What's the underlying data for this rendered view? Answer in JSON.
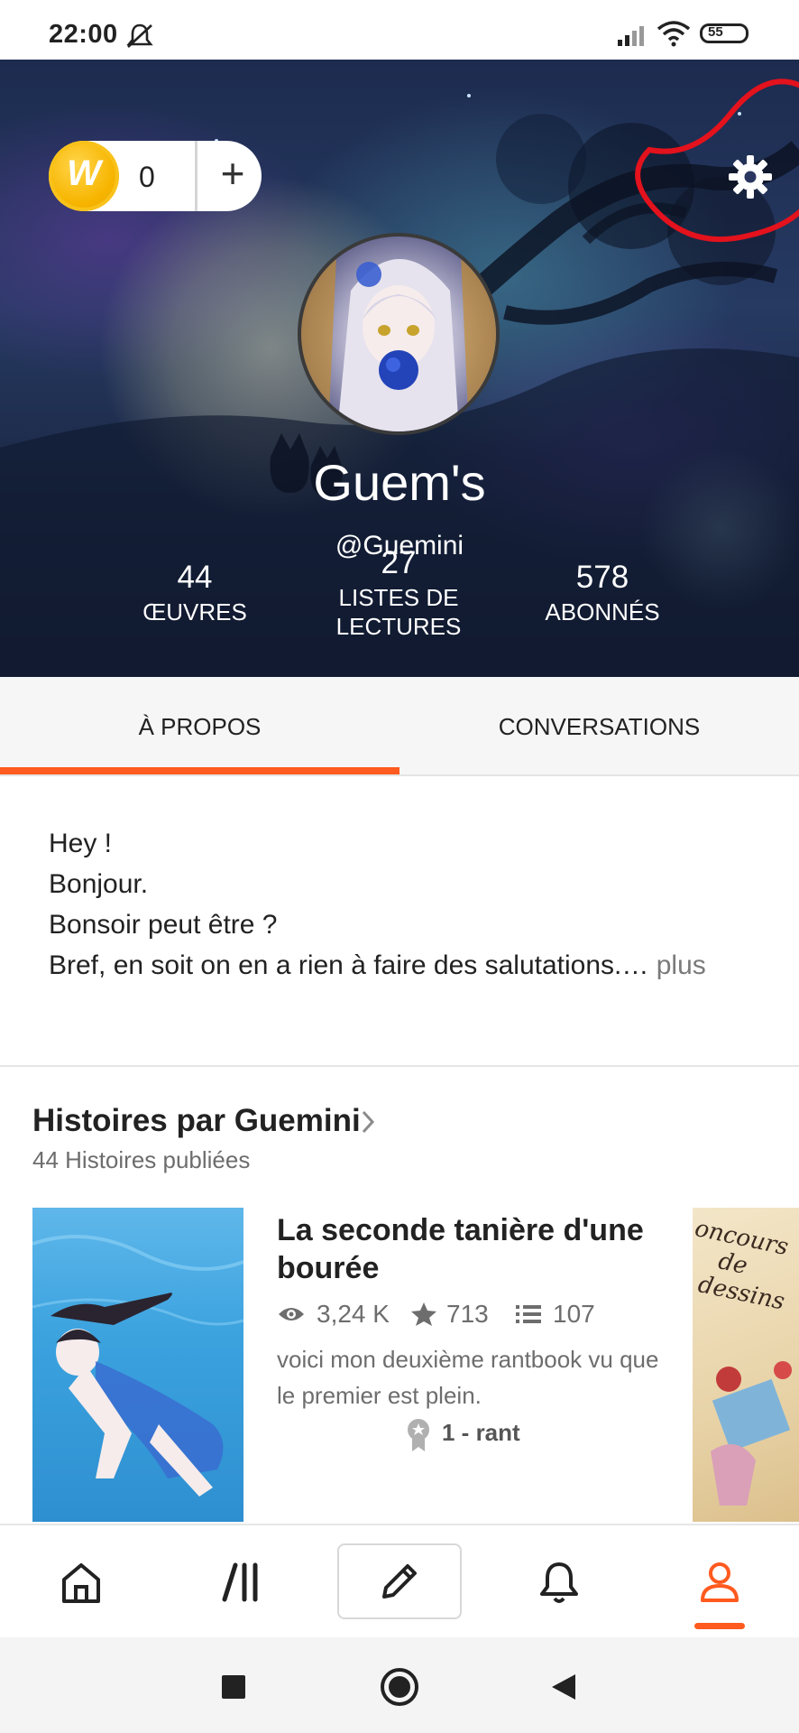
{
  "status_bar": {
    "time": "22:00",
    "battery": "55"
  },
  "wallet": {
    "coin_count": "0",
    "add_label": "+",
    "coin_letter": "W"
  },
  "profile": {
    "display_name": "Guem's",
    "username": "@Guemini",
    "stats": [
      {
        "number": "44",
        "label": "ŒUVRES"
      },
      {
        "number": "27",
        "label_line1": "LISTES DE",
        "label_line2": "LECTURES"
      },
      {
        "number": "578",
        "label": "ABONNÉS"
      }
    ]
  },
  "tabs": [
    {
      "label": "À PROPOS",
      "active": true
    },
    {
      "label": "CONVERSATIONS",
      "active": false
    }
  ],
  "about": {
    "lines": [
      "Hey !",
      "Bonjour.",
      "Bonsoir peut être ?",
      "Bref, en soit on en a rien à faire des salutations.…"
    ],
    "more_label": " plus"
  },
  "stories": {
    "title": "Histoires par Guemini",
    "subtitle": "44 Histoires publiées",
    "items": [
      {
        "title": "La seconde tanière d'une bourée",
        "reads": "3,24 K",
        "votes": "713",
        "parts": "107",
        "description": "voici mon deuxième rantbook vu que le premier est plein.",
        "part_label": "1 - rant"
      }
    ],
    "next_cover_text": "oncours\n    de\n  dessins"
  },
  "colors": {
    "accent": "#ff5a1f",
    "text": "#222222",
    "muted": "#6d6d6d"
  },
  "icons": {
    "top": [
      "coin-icon",
      "plus-icon",
      "gear-icon"
    ],
    "bottom_nav": [
      "home-icon",
      "library-icon",
      "pencil-icon",
      "bell-icon",
      "profile-icon"
    ],
    "system_nav": [
      "square-icon",
      "circle-icon",
      "back-triangle-icon"
    ]
  }
}
